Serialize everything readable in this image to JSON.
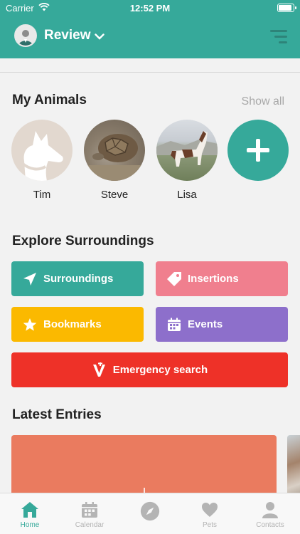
{
  "status_bar": {
    "carrier": "Carrier",
    "time": "12:52 PM"
  },
  "header": {
    "title": "Review"
  },
  "animals": {
    "title": "My Animals",
    "show_all": "Show all",
    "items": [
      {
        "name": "Tim"
      },
      {
        "name": "Steve"
      },
      {
        "name": "Lisa"
      }
    ]
  },
  "explore": {
    "title": "Explore Surroundings",
    "tiles": [
      {
        "label": "Surroundings",
        "color": "#36a99a",
        "icon": "location-arrow-icon"
      },
      {
        "label": "Insertions",
        "color": "#f07f8e",
        "icon": "tag-icon"
      },
      {
        "label": "Bookmarks",
        "color": "#fbb900",
        "icon": "star-icon"
      },
      {
        "label": "Events",
        "color": "#8d6fcb",
        "icon": "calendar-icon"
      },
      {
        "label": "Emergency search",
        "color": "#ee3128",
        "icon": "emergency-logo-icon"
      }
    ]
  },
  "latest": {
    "title": "Latest Entries"
  },
  "tabbar": {
    "tabs": [
      {
        "label": "Home",
        "icon": "home-icon",
        "active": true
      },
      {
        "label": "Calendar",
        "icon": "calendar-icon",
        "active": false
      },
      {
        "label": "",
        "icon": "compass-icon",
        "active": false
      },
      {
        "label": "Pets",
        "icon": "heart-icon",
        "active": false
      },
      {
        "label": "Contacts",
        "icon": "person-icon",
        "active": false
      }
    ]
  },
  "colors": {
    "brand": "#36a99a",
    "background": "#f2f2f2",
    "inactive": "#b4b4b4"
  }
}
